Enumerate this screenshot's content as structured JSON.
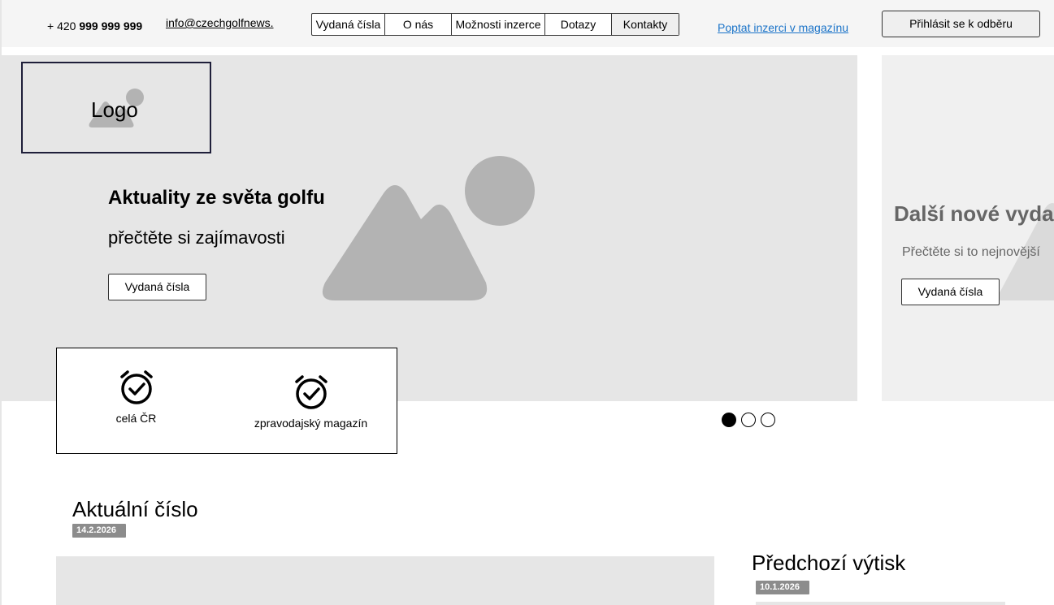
{
  "header": {
    "phone_prefix": "+ 420",
    "phone_number": "999 999 999",
    "email": "info@czechgolfnews.",
    "nav": [
      {
        "label": "Vydaná čísla"
      },
      {
        "label": "O nás"
      },
      {
        "label": "Možnosti inzerce"
      },
      {
        "label": "Dotazy"
      },
      {
        "label": "Kontakty"
      }
    ],
    "ad_link": "Poptat inzerci v magazínu",
    "subscribe_label": "Přihlásit se k odběru"
  },
  "hero": {
    "logo_label": "Logo",
    "title": "Aktuality ze světa golfu",
    "subtitle": "přečtěte si zajímavosti",
    "button_label": "Vydaná čísla",
    "next_slide": {
      "title": "Další nové vyda",
      "subtitle": "Přečtěte si to nejnovější",
      "button_label": "Vydaná čísla"
    }
  },
  "features": [
    {
      "icon": "alarm-clock-check-icon",
      "label": "celá ČR"
    },
    {
      "icon": "alarm-clock-check-icon",
      "label": "zpravodajský magazín"
    }
  ],
  "carousel": {
    "active_index": 0,
    "count": 3
  },
  "current_issue": {
    "title": "Aktuální číslo",
    "date": "14.2.2026"
  },
  "previous_issue": {
    "title": "Předchozí výtisk",
    "date": "10.1.2026"
  },
  "colors": {
    "topbar_bg": "#f5f5f5",
    "placeholder_bg": "#e6e6e6",
    "placeholder_shape": "#b3b3b3",
    "link": "#1a73c8",
    "badge_bg": "#8c8c8c"
  }
}
